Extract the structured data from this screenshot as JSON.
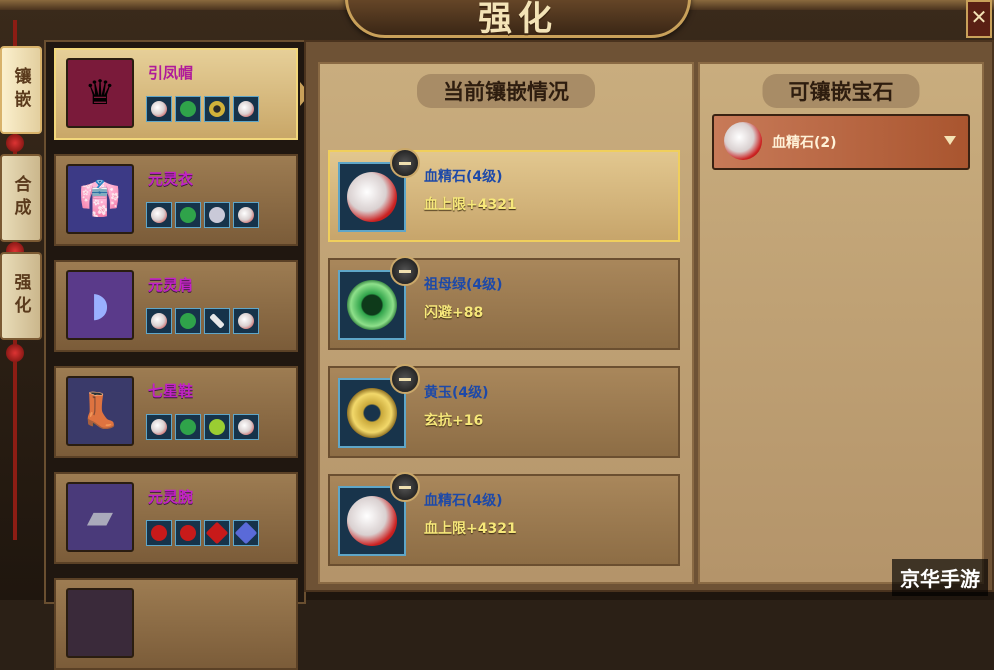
{
  "window": {
    "title": "强化",
    "close_symbol": "✕"
  },
  "side_tabs": [
    {
      "label": "镶嵌"
    },
    {
      "label": "合成"
    },
    {
      "label": "强化"
    }
  ],
  "equipment": [
    {
      "name": "引凤帽",
      "icon": "phoenix-crown-icon",
      "icon_glyph": "♛",
      "icon_color": "#7a1a3a",
      "gems": [
        "#d9d0d0",
        "#2fa34a",
        "#d1b23a",
        "#d9d0d0"
      ]
    },
    {
      "name": "元灵衣",
      "icon": "robe-icon",
      "icon_glyph": "👘",
      "icon_color": "#3c3a86",
      "gems": [
        "#d9d0d0",
        "#2fa34a",
        "#c9c9d8",
        "#d9d0d0"
      ]
    },
    {
      "name": "元灵肩",
      "icon": "shoulder-icon",
      "icon_glyph": "◗",
      "icon_color": "#5a3a8a",
      "gems": [
        "#d9d0d0",
        "#2fa34a",
        "#e8e8e8",
        "#d9d0d0"
      ]
    },
    {
      "name": "七星鞋",
      "icon": "boots-icon",
      "icon_glyph": "👢",
      "icon_color": "#3a3a6a",
      "gems": [
        "#d9d0d0",
        "#2fa34a",
        "#9acd32",
        "#d9d0d0"
      ]
    },
    {
      "name": "元灵腕",
      "icon": "bracer-icon",
      "icon_glyph": "▰",
      "icon_color": "#4a3a7a",
      "gems": [
        "#c81a1a",
        "#c81a1a",
        "#c81a1a",
        "#5a6ad8"
      ]
    },
    {
      "name": "",
      "icon": "item-icon",
      "icon_glyph": "",
      "icon_color": "#3a2a3a",
      "gems": []
    }
  ],
  "inlay": {
    "title": "当前镶嵌情况",
    "slots": [
      {
        "gem_name": "血精石(4级)",
        "stat": "血上限+4321",
        "gem_color": "#c81a1a",
        "selected": true
      },
      {
        "gem_name": "祖母绿(4级)",
        "stat": "闪避+88",
        "gem_color": "#2fa34a",
        "selected": false
      },
      {
        "gem_name": "黄玉(4级)",
        "stat": "玄抗+16",
        "gem_color": "#d1b23a",
        "selected": false
      },
      {
        "gem_name": "血精石(4级)",
        "stat": "血上限+4321",
        "gem_color": "#c81a1a",
        "selected": false
      }
    ]
  },
  "gems_panel": {
    "title": "可镶嵌宝石",
    "selected_gem": "血精石(2)"
  },
  "watermark": "京华手游"
}
